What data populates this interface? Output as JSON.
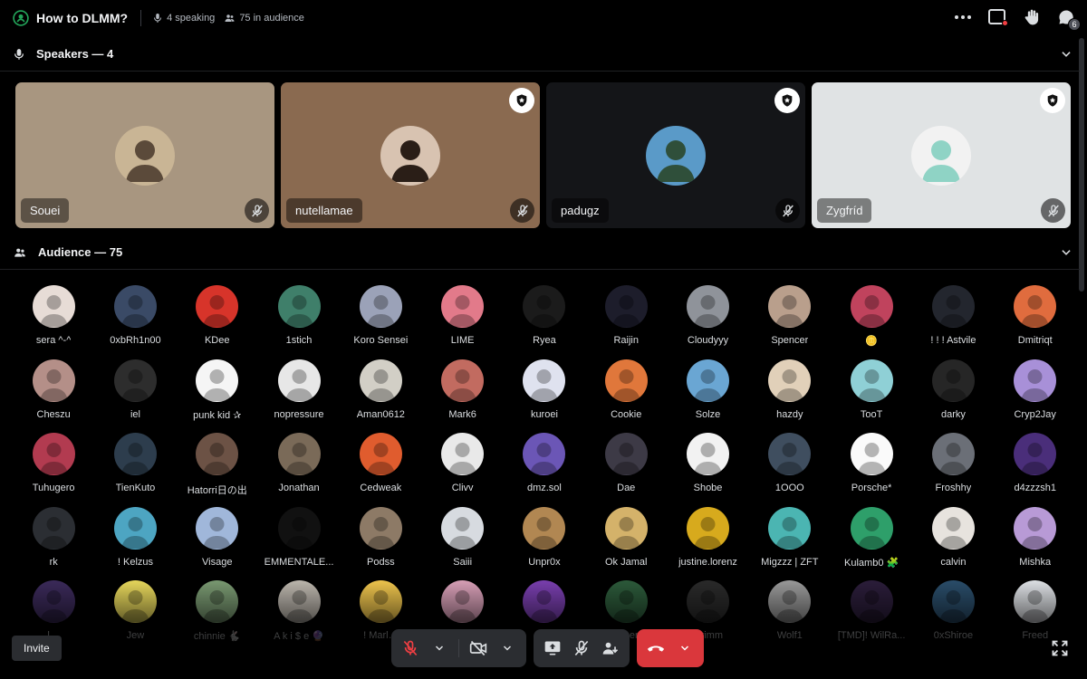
{
  "header": {
    "title": "How to DLMM?",
    "speaking": "4 speaking",
    "audience_count": "75 in audience"
  },
  "speakers_section": {
    "label": "Speakers — 4"
  },
  "speakers": [
    {
      "name": "Souei",
      "bg": "#a89680",
      "avatar_bg": "#c9b595",
      "avatar_fg": "#5b4a3a",
      "moderator": false
    },
    {
      "name": "nutellamae",
      "bg": "#8a6a50",
      "avatar_bg": "#d8c3b1",
      "avatar_fg": "#2a1e17",
      "moderator": true
    },
    {
      "name": "padugz",
      "bg": "#141518",
      "avatar_bg": "#5a9ac8",
      "avatar_fg": "#2f4f3a",
      "moderator": true
    },
    {
      "name": "Zygfríd",
      "bg": "#e0e3e4",
      "avatar_bg": "#f2f2f2",
      "avatar_fg": "#8fd3c5",
      "moderator": true
    }
  ],
  "audience_section": {
    "label": "Audience — 75"
  },
  "audience": [
    {
      "name": "sera ^-^",
      "color": "#e7dcd6"
    },
    {
      "name": "0xbRh1n00",
      "color": "#3a4a66"
    },
    {
      "name": "KDee",
      "color": "#d7342a"
    },
    {
      "name": "1stich",
      "color": "#3f7f6a"
    },
    {
      "name": "Koro Sensei",
      "color": "#9ba2b8"
    },
    {
      "name": "LIME",
      "color": "#e27a8a"
    },
    {
      "name": "Ryea",
      "color": "#1b1b1b"
    },
    {
      "name": "Raijin",
      "color": "#1d1d2b"
    },
    {
      "name": "Cloudyyy",
      "color": "#8f939a"
    },
    {
      "name": "Spencer",
      "color": "#b99f8c"
    },
    {
      "name": "🪙",
      "color": "#c0435d"
    },
    {
      "name": "! ! ! Astvile",
      "color": "#23262e"
    },
    {
      "name": "Dmitriqt",
      "color": "#e06c3e"
    },
    {
      "name": "Cheszu",
      "color": "#b48f88"
    },
    {
      "name": "iel",
      "color": "#2d2d2d"
    },
    {
      "name": "punk kid ✰",
      "color": "#f5f5f5"
    },
    {
      "name": "nopressure",
      "color": "#e7e7e7"
    },
    {
      "name": "Aman0612",
      "color": "#d2cfc6"
    },
    {
      "name": "Mark6",
      "color": "#c26b60"
    },
    {
      "name": "kuroei",
      "color": "#dfe2ef"
    },
    {
      "name": "Cookie",
      "color": "#e0773b"
    },
    {
      "name": "Solze",
      "color": "#6aa6d3"
    },
    {
      "name": "hazdy",
      "color": "#e1d0b9"
    },
    {
      "name": "TooT",
      "color": "#8fd0d6"
    },
    {
      "name": "darky",
      "color": "#262626"
    },
    {
      "name": "Cryp2Jay",
      "color": "#a890d8"
    },
    {
      "name": "Tuhugero",
      "color": "#b23b50"
    },
    {
      "name": "TienKuto",
      "color": "#2d3d4d"
    },
    {
      "name": "Hatorri日の出",
      "color": "#6c5245"
    },
    {
      "name": "Jonathan",
      "color": "#7a6a58"
    },
    {
      "name": "Cedweak",
      "color": "#e05c2e"
    },
    {
      "name": "Clivv",
      "color": "#e9e9e9"
    },
    {
      "name": "dmz.sol",
      "color": "#6b56b6"
    },
    {
      "name": "Dae",
      "color": "#3d3a46"
    },
    {
      "name": "Shobe",
      "color": "#f2f2f2"
    },
    {
      "name": "1OOO",
      "color": "#3f4e5f"
    },
    {
      "name": "Porsche*",
      "color": "#fafafa"
    },
    {
      "name": "Froshhy",
      "color": "#6b6f77"
    },
    {
      "name": "d4zzzsh1",
      "color": "#4a2e7a"
    },
    {
      "name": "rk",
      "color": "#2b2e33"
    },
    {
      "name": "! Kelzus",
      "color": "#4da5c2"
    },
    {
      "name": "Visage",
      "color": "#a0b7da"
    },
    {
      "name": "EMMENTALE...",
      "color": "#111111"
    },
    {
      "name": "Podss",
      "color": "#8d7a66"
    },
    {
      "name": "Saiii",
      "color": "#d7dbe0"
    },
    {
      "name": "Unpr0x",
      "color": "#b18752"
    },
    {
      "name": "Ok Jamal",
      "color": "#d4b26a"
    },
    {
      "name": "justine.lorenz",
      "color": "#d7aa1d"
    },
    {
      "name": "Migzzz | ZFT",
      "color": "#4bb5b2"
    },
    {
      "name": "Kulamb0 🧩",
      "color": "#2e9f6a"
    },
    {
      "name": "calvin",
      "color": "#e7e3de"
    },
    {
      "name": "Mishka",
      "color": "#b89ad6"
    },
    {
      "name": "l…",
      "color": "#3b2a5a"
    },
    {
      "name": "Jew",
      "color": "#e8d85c"
    },
    {
      "name": "chinnie 🐇",
      "color": "#7a9a72"
    },
    {
      "name": "A k i $ e 🔮",
      "color": "#bdb7ae"
    },
    {
      "name": "! Marl…",
      "color": "#f0c64d"
    },
    {
      "name": "",
      "color": "#d9a0b8"
    },
    {
      "name": "",
      "color": "#7a3fb0"
    },
    {
      "name": "…ger",
      "color": "#2c5a3a"
    },
    {
      "name": "Grimm",
      "color": "#2a2a2a"
    },
    {
      "name": "Wolf1",
      "color": "#9a9a9a"
    },
    {
      "name": "[TMD]! WilRa...",
      "color": "#2b1d3a"
    },
    {
      "name": "0xShiroe",
      "color": "#2a4d6a"
    },
    {
      "name": "Freed",
      "color": "#dfe2e6"
    }
  ],
  "controls": {
    "invite_label": "Invite"
  },
  "colors": {
    "end_call": "#da373c",
    "panel": "#2b2d31",
    "accent_green": "#23a55a"
  },
  "icons": [
    "stage-icon",
    "microphone-icon",
    "audience-icon",
    "more-icon",
    "screen-icon",
    "raise-hand-icon",
    "threads-icon",
    "chevron-down-icon",
    "mute-icon",
    "mod-shield-icon",
    "video-off-icon",
    "share-screen-icon",
    "move-to-audience-icon",
    "hang-up-icon",
    "fullscreen-icon"
  ]
}
